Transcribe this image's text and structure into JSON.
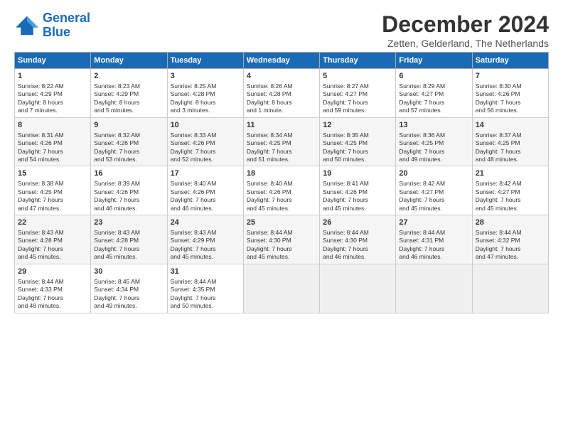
{
  "header": {
    "logo_line1": "General",
    "logo_line2": "Blue",
    "title": "December 2024",
    "subtitle": "Zetten, Gelderland, The Netherlands"
  },
  "columns": [
    "Sunday",
    "Monday",
    "Tuesday",
    "Wednesday",
    "Thursday",
    "Friday",
    "Saturday"
  ],
  "weeks": [
    [
      {
        "day": "1",
        "lines": [
          "Sunrise: 8:22 AM",
          "Sunset: 4:29 PM",
          "Daylight: 8 hours",
          "and 7 minutes."
        ]
      },
      {
        "day": "2",
        "lines": [
          "Sunrise: 8:23 AM",
          "Sunset: 4:29 PM",
          "Daylight: 8 hours",
          "and 5 minutes."
        ]
      },
      {
        "day": "3",
        "lines": [
          "Sunrise: 8:25 AM",
          "Sunset: 4:28 PM",
          "Daylight: 8 hours",
          "and 3 minutes."
        ]
      },
      {
        "day": "4",
        "lines": [
          "Sunrise: 8:26 AM",
          "Sunset: 4:28 PM",
          "Daylight: 8 hours",
          "and 1 minute."
        ]
      },
      {
        "day": "5",
        "lines": [
          "Sunrise: 8:27 AM",
          "Sunset: 4:27 PM",
          "Daylight: 7 hours",
          "and 59 minutes."
        ]
      },
      {
        "day": "6",
        "lines": [
          "Sunrise: 8:29 AM",
          "Sunset: 4:27 PM",
          "Daylight: 7 hours",
          "and 57 minutes."
        ]
      },
      {
        "day": "7",
        "lines": [
          "Sunrise: 8:30 AM",
          "Sunset: 4:26 PM",
          "Daylight: 7 hours",
          "and 56 minutes."
        ]
      }
    ],
    [
      {
        "day": "8",
        "lines": [
          "Sunrise: 8:31 AM",
          "Sunset: 4:26 PM",
          "Daylight: 7 hours",
          "and 54 minutes."
        ]
      },
      {
        "day": "9",
        "lines": [
          "Sunrise: 8:32 AM",
          "Sunset: 4:26 PM",
          "Daylight: 7 hours",
          "and 53 minutes."
        ]
      },
      {
        "day": "10",
        "lines": [
          "Sunrise: 8:33 AM",
          "Sunset: 4:26 PM",
          "Daylight: 7 hours",
          "and 52 minutes."
        ]
      },
      {
        "day": "11",
        "lines": [
          "Sunrise: 8:34 AM",
          "Sunset: 4:25 PM",
          "Daylight: 7 hours",
          "and 51 minutes."
        ]
      },
      {
        "day": "12",
        "lines": [
          "Sunrise: 8:35 AM",
          "Sunset: 4:25 PM",
          "Daylight: 7 hours",
          "and 50 minutes."
        ]
      },
      {
        "day": "13",
        "lines": [
          "Sunrise: 8:36 AM",
          "Sunset: 4:25 PM",
          "Daylight: 7 hours",
          "and 49 minutes."
        ]
      },
      {
        "day": "14",
        "lines": [
          "Sunrise: 8:37 AM",
          "Sunset: 4:25 PM",
          "Daylight: 7 hours",
          "and 48 minutes."
        ]
      }
    ],
    [
      {
        "day": "15",
        "lines": [
          "Sunrise: 8:38 AM",
          "Sunset: 4:25 PM",
          "Daylight: 7 hours",
          "and 47 minutes."
        ]
      },
      {
        "day": "16",
        "lines": [
          "Sunrise: 8:39 AM",
          "Sunset: 4:26 PM",
          "Daylight: 7 hours",
          "and 46 minutes."
        ]
      },
      {
        "day": "17",
        "lines": [
          "Sunrise: 8:40 AM",
          "Sunset: 4:26 PM",
          "Daylight: 7 hours",
          "and 46 minutes."
        ]
      },
      {
        "day": "18",
        "lines": [
          "Sunrise: 8:40 AM",
          "Sunset: 4:26 PM",
          "Daylight: 7 hours",
          "and 45 minutes."
        ]
      },
      {
        "day": "19",
        "lines": [
          "Sunrise: 8:41 AM",
          "Sunset: 4:26 PM",
          "Daylight: 7 hours",
          "and 45 minutes."
        ]
      },
      {
        "day": "20",
        "lines": [
          "Sunrise: 8:42 AM",
          "Sunset: 4:27 PM",
          "Daylight: 7 hours",
          "and 45 minutes."
        ]
      },
      {
        "day": "21",
        "lines": [
          "Sunrise: 8:42 AM",
          "Sunset: 4:27 PM",
          "Daylight: 7 hours",
          "and 45 minutes."
        ]
      }
    ],
    [
      {
        "day": "22",
        "lines": [
          "Sunrise: 8:43 AM",
          "Sunset: 4:28 PM",
          "Daylight: 7 hours",
          "and 45 minutes."
        ]
      },
      {
        "day": "23",
        "lines": [
          "Sunrise: 8:43 AM",
          "Sunset: 4:28 PM",
          "Daylight: 7 hours",
          "and 45 minutes."
        ]
      },
      {
        "day": "24",
        "lines": [
          "Sunrise: 8:43 AM",
          "Sunset: 4:29 PM",
          "Daylight: 7 hours",
          "and 45 minutes."
        ]
      },
      {
        "day": "25",
        "lines": [
          "Sunrise: 8:44 AM",
          "Sunset: 4:30 PM",
          "Daylight: 7 hours",
          "and 45 minutes."
        ]
      },
      {
        "day": "26",
        "lines": [
          "Sunrise: 8:44 AM",
          "Sunset: 4:30 PM",
          "Daylight: 7 hours",
          "and 46 minutes."
        ]
      },
      {
        "day": "27",
        "lines": [
          "Sunrise: 8:44 AM",
          "Sunset: 4:31 PM",
          "Daylight: 7 hours",
          "and 46 minutes."
        ]
      },
      {
        "day": "28",
        "lines": [
          "Sunrise: 8:44 AM",
          "Sunset: 4:32 PM",
          "Daylight: 7 hours",
          "and 47 minutes."
        ]
      }
    ],
    [
      {
        "day": "29",
        "lines": [
          "Sunrise: 8:44 AM",
          "Sunset: 4:33 PM",
          "Daylight: 7 hours",
          "and 48 minutes."
        ]
      },
      {
        "day": "30",
        "lines": [
          "Sunrise: 8:45 AM",
          "Sunset: 4:34 PM",
          "Daylight: 7 hours",
          "and 49 minutes."
        ]
      },
      {
        "day": "31",
        "lines": [
          "Sunrise: 8:44 AM",
          "Sunset: 4:35 PM",
          "Daylight: 7 hours",
          "and 50 minutes."
        ]
      },
      null,
      null,
      null,
      null
    ]
  ]
}
